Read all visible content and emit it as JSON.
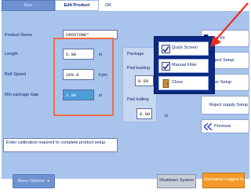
{
  "tabs": {
    "run": "Run",
    "edit_product": "Edit Product",
    "ok": "OK"
  },
  "form": {
    "product_name_label": "Product Name",
    "product_name_value": "CROSTONE*",
    "length_label": "Length",
    "length_value": "5.00",
    "length_unit": "in",
    "belt_speed_label": "Belt Speed",
    "belt_speed_value": "100.0",
    "belt_speed_unit": "Fpm",
    "min_gap_label": "Min package Gap",
    "min_gap_value": "2.00",
    "min_gap_unit": "in"
  },
  "package": {
    "label": "Package",
    "pad_left_label": "Pad leading",
    "pad_left_value": "0.50",
    "pad_trailing_label": "Pad trailing",
    "pad_bottom_value": "0.00",
    "pad_bottom_unit": "in"
  },
  "popup": {
    "quick_screen": "Quick Screen",
    "manual_filter": "Manual Filter",
    "close": "Close"
  },
  "side": {
    "filter_label": "Filter Fil",
    "reject_label": "Reject Setup",
    "filter_setup_label": "Filter Setup",
    "reject_supply_label": "Reject supply Setup",
    "previous_label": "Previous"
  },
  "message": "Enter calibration required to complete product setup",
  "footer": {
    "menu_label": "Menu Options",
    "shutdown_label": "Shutdown System",
    "logged_in_label": "Username Logged In"
  },
  "colors": {
    "panel_bg": "#a9c4ec",
    "popup_bg": "#0b2a86",
    "highlight_red": "#f26a46",
    "selected_field": "#4d9cd8",
    "logged_in_orange": "#f39a2a"
  }
}
